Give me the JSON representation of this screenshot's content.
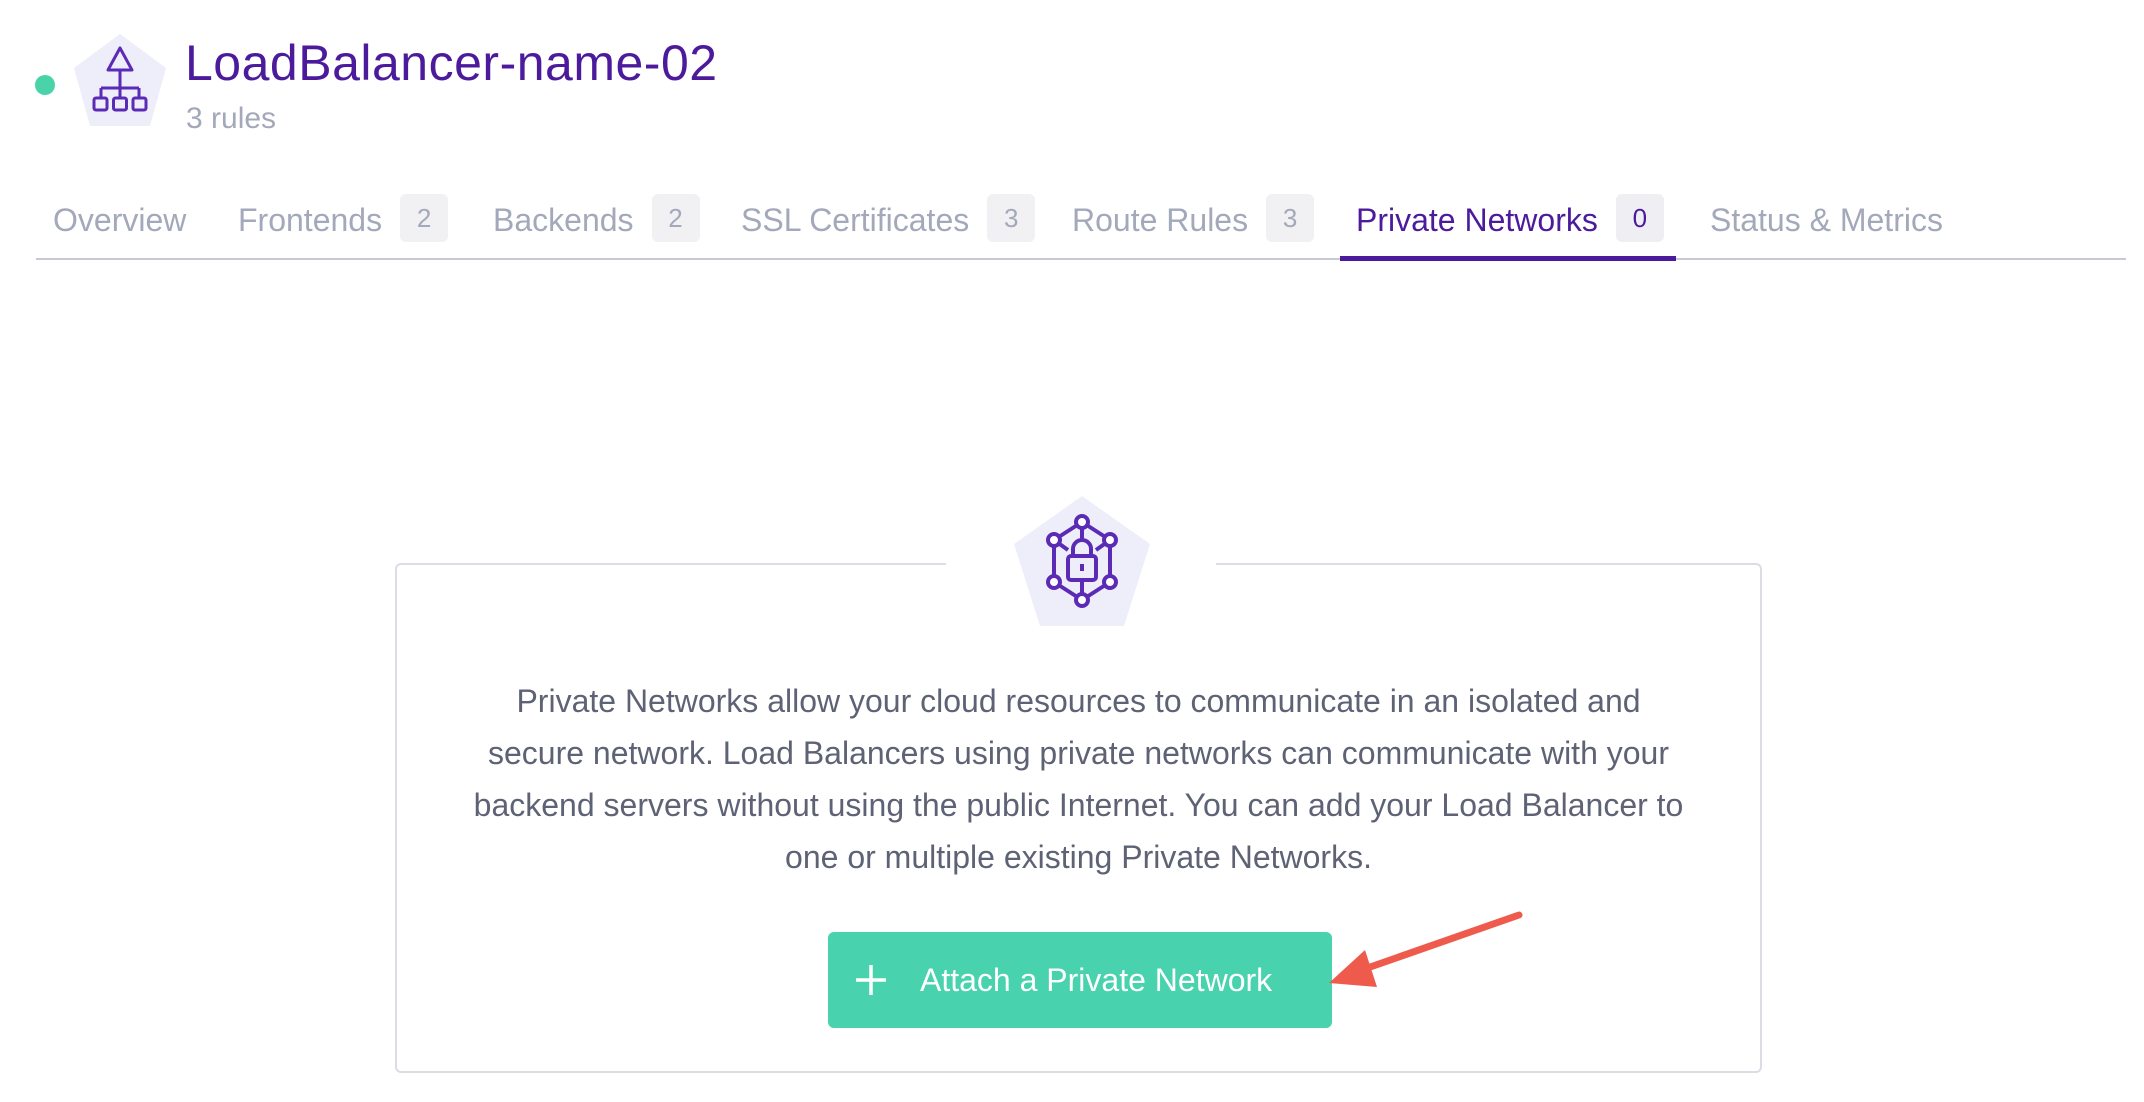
{
  "header": {
    "title": "LoadBalancer-name-02",
    "subtitle": "3 rules",
    "status_color": "#4ad3a9",
    "icon": "load-balancer-icon"
  },
  "tabs": [
    {
      "label": "Overview",
      "count": null,
      "active": false
    },
    {
      "label": "Frontends",
      "count": "2",
      "active": false
    },
    {
      "label": "Backends",
      "count": "2",
      "active": false
    },
    {
      "label": "SSL Certificates",
      "count": "3",
      "active": false
    },
    {
      "label": "Route Rules",
      "count": "3",
      "active": false
    },
    {
      "label": "Private Networks",
      "count": "0",
      "active": true
    },
    {
      "label": "Status & Metrics",
      "count": null,
      "active": false
    }
  ],
  "empty_state": {
    "icon": "private-network-lock-icon",
    "description": "Private Networks allow your cloud resources to communicate in an isolated and secure network. Load Balancers using private networks can communicate with your backend servers without using the public Internet. You can add your Load Balancer to one or multiple existing Private Networks.",
    "button_label": "Attach a Private Network",
    "button_icon": "plus-icon"
  },
  "colors": {
    "accent": "#4c1b9c",
    "button": "#48d2ad",
    "annotation_arrow": "#ee5b4d"
  }
}
